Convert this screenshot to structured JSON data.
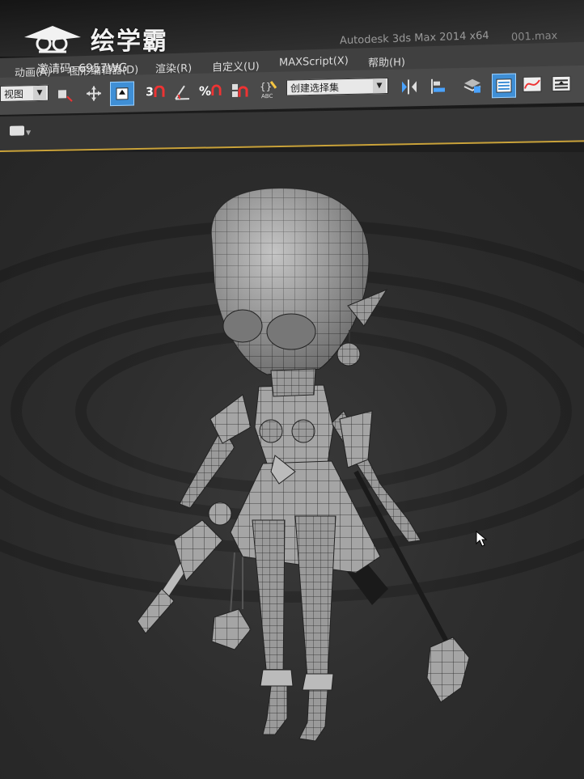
{
  "watermark": {
    "brand": "绘学霸",
    "invite_code": "邀请码: 6957WG"
  },
  "titlebar": {
    "app_title": "Autodesk 3ds Max  2014 x64",
    "file_name": "001.max"
  },
  "menu": {
    "items": [
      "动画(A)",
      "图形编辑器(D)",
      "渲染(R)",
      "自定义(U)",
      "MAXScript(X)",
      "帮助(H)"
    ]
  },
  "toolbar": {
    "view_dropdown": "视图",
    "selection_set_dropdown": "创建选择集",
    "snap_3": "3",
    "snap_percent": "%",
    "icons": [
      "select-link-icon",
      "move-icon",
      "select-object-icon",
      "snap-toggle-icon",
      "angle-snap-icon",
      "percent-snap-icon",
      "spinner-snap-icon",
      "edit-named-selection-icon",
      "mirror-icon",
      "align-icon",
      "layer-manager-icon",
      "scene-explorer-icon",
      "curve-editor-icon",
      "schematic-view-icon"
    ]
  },
  "viewport": {
    "content": "character-wireframe-model"
  },
  "colors": {
    "accent_blue": "#3f8fd6",
    "viewport_border": "#c9a23a",
    "menu_bg": "#404040",
    "toolbar_bg": "#4a4a4a"
  }
}
